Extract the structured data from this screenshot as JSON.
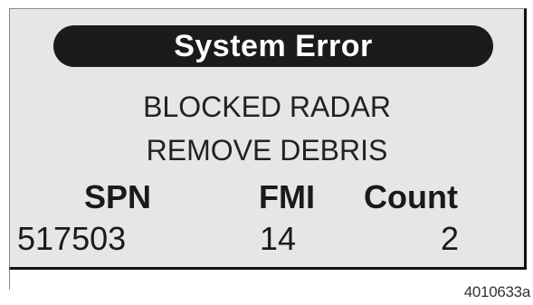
{
  "display": {
    "title": "System Error",
    "message_line_1": "BLOCKED RADAR",
    "message_line_2": "REMOVE DEBRIS",
    "columns": {
      "spn_label": "SPN",
      "fmi_label": "FMI",
      "count_label": "Count"
    },
    "values": {
      "spn": "517503",
      "fmi": "14",
      "count": "2"
    }
  },
  "figure_id": "4010633a"
}
